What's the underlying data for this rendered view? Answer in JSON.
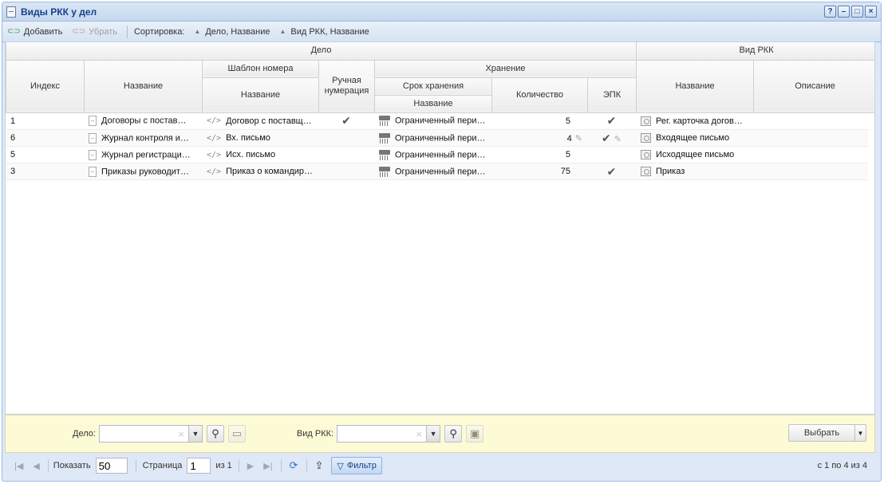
{
  "window": {
    "title": "Виды РКК у дел",
    "help_icon": "question-icon",
    "minimize_icon": "minimize-icon",
    "maximize_icon": "maximize-icon",
    "close_icon": "close-icon"
  },
  "toolbar": {
    "add_label": "Добавить",
    "remove_label": "Убрать",
    "sort_label": "Сортировка:",
    "sort_items": [
      "Дело, Название",
      "Вид РКК, Название"
    ]
  },
  "headers": {
    "delo": "Дело",
    "vid_rkk": "Вид РКК",
    "index": "Индекс",
    "name": "Название",
    "number_template": "Шаблон номера",
    "manual_numbering": "Ручная нумерация",
    "storage": "Хранение",
    "storage_period": "Срок хранения",
    "quantity": "Количество",
    "epk": "ЭПК",
    "description": "Описание"
  },
  "rows": [
    {
      "index": "1",
      "delo_name": "Договоры с постав…",
      "template": "Договор с поставщи…",
      "manual": true,
      "period": "Ограниченный пери…",
      "quantity": "5",
      "qty_editable": false,
      "epk": true,
      "epk_editable": false,
      "rkk_name": "Рег. карточка догов…",
      "rkk_desc": ""
    },
    {
      "index": "6",
      "delo_name": "Журнал контроля и…",
      "template": "Вх. письмо",
      "manual": false,
      "period": "Ограниченный пери…",
      "quantity": "4",
      "qty_editable": true,
      "epk": true,
      "epk_editable": true,
      "rkk_name": "Входящее письмо",
      "rkk_desc": ""
    },
    {
      "index": "5",
      "delo_name": "Журнал регистраци…",
      "template": "Исх. письмо",
      "manual": false,
      "period": "Ограниченный пери…",
      "quantity": "5",
      "qty_editable": false,
      "epk": false,
      "epk_editable": false,
      "rkk_name": "Исходящее письмо",
      "rkk_desc": ""
    },
    {
      "index": "3",
      "delo_name": "Приказы руководит…",
      "template": "Приказ о командиро…",
      "manual": false,
      "period": "Ограниченный пери…",
      "quantity": "75",
      "qty_editable": false,
      "epk": true,
      "epk_editable": false,
      "rkk_name": "Приказ",
      "rkk_desc": ""
    }
  ],
  "filter": {
    "delo_label": "Дело:",
    "delo_value": "",
    "vid_rkk_label": "Вид РКК:",
    "vid_rkk_value": "",
    "select_label": "Выбрать"
  },
  "pager": {
    "show_label": "Показать",
    "page_size": "50",
    "page_label": "Страница",
    "page_value": "1",
    "of_label": "из 1",
    "filter_label": "Фильтр",
    "summary": "с 1 по 4 из 4"
  },
  "colors": {
    "window_border": "#99bbe8",
    "title_text": "#15428b",
    "filter_bg": "#fdfbd6"
  }
}
